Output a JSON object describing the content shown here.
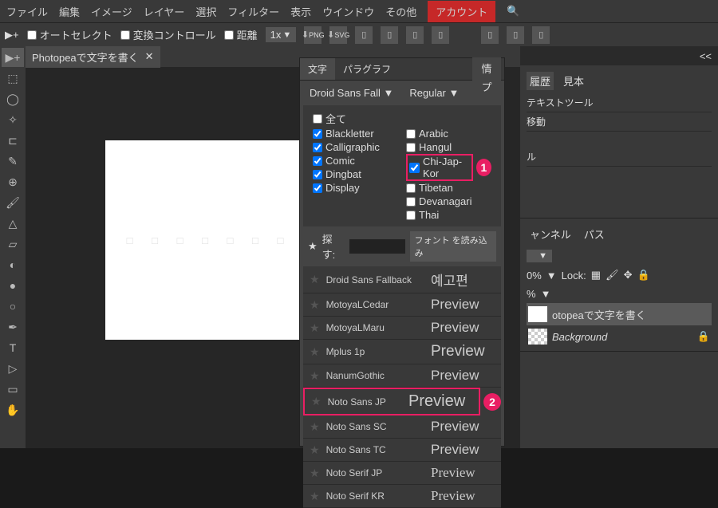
{
  "menu": [
    "ファイル",
    "編集",
    "イメージ",
    "レイヤー",
    "選択",
    "フィルター",
    "表示",
    "ウインドウ",
    "その他"
  ],
  "account": "アカウント",
  "opt": {
    "auto": "オートセレクト",
    "trans": "変換コントロール",
    "dist": "距離",
    "zoom": "1x",
    "png": "PNG",
    "svg": "SVG"
  },
  "doc": {
    "title": "Photopeaで文字を書く"
  },
  "canvas_text": "□ □ □ □ □ □ □",
  "char": {
    "tab1": "文字",
    "tab2": "パラグラフ",
    "font": "Droid Sans Fall",
    "weight": "Regular",
    "all": "全て",
    "left": [
      "Blackletter",
      "Calligraphic",
      "Comic",
      "Dingbat",
      "Display"
    ],
    "right": [
      "Arabic",
      "Hangul",
      "Chi-Jap-Kor",
      "Tibetan",
      "Devanagari",
      "Thai"
    ],
    "search": "探す:",
    "load": "フォント を読み込み",
    "fonts": [
      {
        "n": "Droid Sans Fallback",
        "p": "예고편"
      },
      {
        "n": "MotoyaLCedar",
        "p": "Preview"
      },
      {
        "n": "MotoyaLMaru",
        "p": "Preview"
      },
      {
        "n": "Mplus 1p",
        "p": "Preview"
      },
      {
        "n": "NanumGothic",
        "p": "Preview"
      },
      {
        "n": "Noto Sans JP",
        "p": "Preview"
      },
      {
        "n": "Noto Sans SC",
        "p": "Preview"
      },
      {
        "n": "Noto Sans TC",
        "p": "Preview"
      },
      {
        "n": "Noto Serif JP",
        "p": "Preview"
      },
      {
        "n": "Noto Serif KR",
        "p": "Preview"
      }
    ]
  },
  "info": [
    "情",
    "プ"
  ],
  "hist": {
    "tab1": "履歴",
    "tab2": "見本",
    "i1": "テキストツール",
    "i2": "移動",
    "i3": "ル"
  },
  "lay": {
    "tab1": "ャンネル",
    "tab2": "パス",
    "opacity": "0%",
    "lock": "Lock:",
    "fill": "%",
    "l1": "otopeaで文字を書く",
    "l2": "Background"
  },
  "badges": {
    "b1": "1",
    "b2": "2"
  },
  "chevron": "<<"
}
